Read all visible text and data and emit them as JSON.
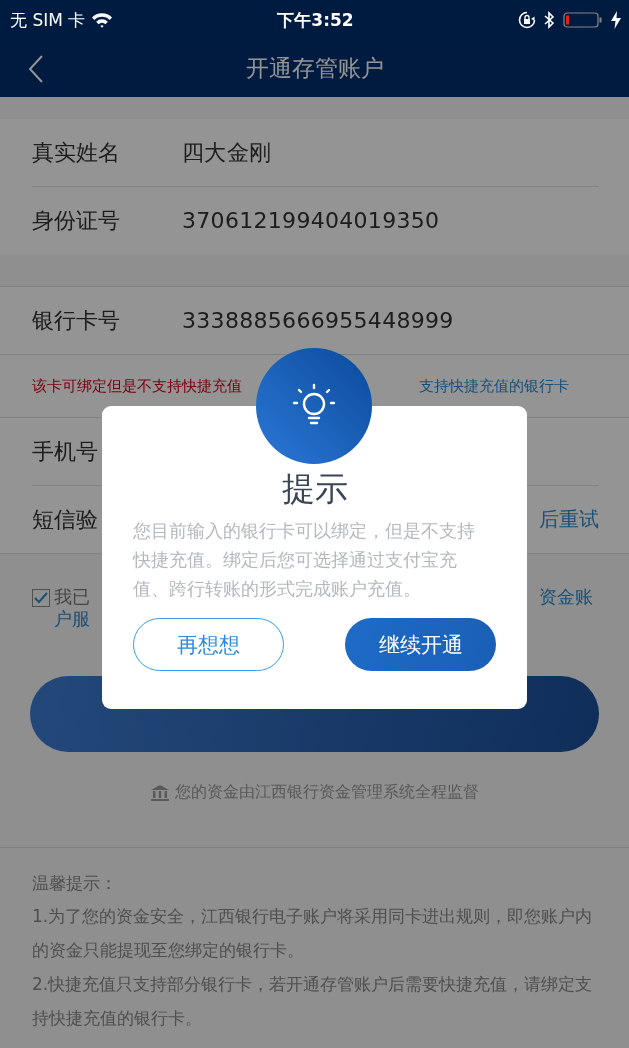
{
  "status_bar": {
    "carrier": "无 SIM 卡",
    "time": "下午3:52"
  },
  "nav": {
    "title": "开通存管账户"
  },
  "form": {
    "fields": [
      {
        "label": "真实姓名",
        "value": "四大金刚"
      },
      {
        "label": "身份证号",
        "value": "370612199404019350"
      }
    ],
    "bank_field": {
      "label": "银行卡号",
      "value": "3338885666955448999"
    },
    "card_notice": {
      "warning": "该卡可绑定但是不支持快捷充值",
      "link": "支持快捷充值的银行卡"
    },
    "phone_field": {
      "label": "手机号"
    },
    "sms_field": {
      "label": "短信验",
      "action": "后重试"
    }
  },
  "agreement": {
    "checked": true,
    "text_start": "我已",
    "link_end": "资金账",
    "link_line2": "户服"
  },
  "supervision_note": "您的资金由江西银行资金管理系统全程监督",
  "tips": {
    "title": "温馨提示：",
    "items": [
      "1.为了您的资金安全，江西银行电子账户将采用同卡进出规则，即您账户内的资金只能提现至您绑定的银行卡。",
      "2.快捷充值只支持部分银行卡，若开通存管账户后需要快捷充值，请绑定支持快捷充值的银行卡。"
    ]
  },
  "dialog": {
    "title": "提示",
    "message": "您目前输入的银行卡可以绑定，但是不支持快捷充值。绑定后您可选择通过支付宝充值、跨行转账的形式完成账户充值。",
    "buttons": [
      {
        "label": "再想想",
        "kind": "secondary"
      },
      {
        "label": "继续开通",
        "kind": "primary"
      }
    ]
  }
}
